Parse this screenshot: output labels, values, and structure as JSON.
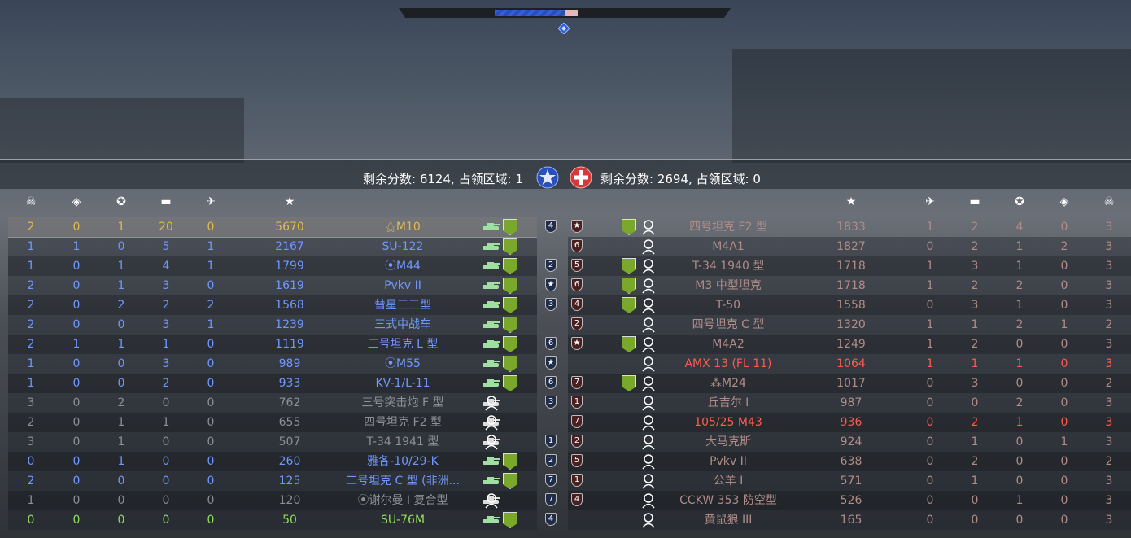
{
  "top": {
    "blue_team_emblem": "star-emblem-icon",
    "red_team_emblem": "cross-emblem-icon"
  },
  "score": {
    "left_text": "剩余分数: 6124, 占领区域: 1",
    "right_text": "剩余分数: 2694, 占领区域: 0"
  },
  "left_headers": [
    "skull-icon",
    "capture-icon",
    "assist-icon",
    "ground-kill-icon",
    "air-kill-icon",
    "score-star-icon"
  ],
  "left_players": [
    {
      "deaths": "2",
      "caps": "0",
      "assists": "1",
      "ground": "20",
      "air": "0",
      "score": "5670",
      "vehicle": "⚝M10",
      "shield": "4",
      "style": "gold"
    },
    {
      "deaths": "1",
      "caps": "1",
      "assists": "0",
      "ground": "5",
      "air": "1",
      "score": "2167",
      "vehicle": "SU-122",
      "shield": "",
      "style": "blue"
    },
    {
      "deaths": "1",
      "caps": "0",
      "assists": "1",
      "ground": "4",
      "air": "1",
      "score": "1799",
      "vehicle": "⦿M44",
      "shield": "2",
      "style": "blue"
    },
    {
      "deaths": "2",
      "caps": "0",
      "assists": "1",
      "ground": "3",
      "air": "0",
      "score": "1619",
      "vehicle": "Pvkv II",
      "shield": "★",
      "style": "blue"
    },
    {
      "deaths": "2",
      "caps": "0",
      "assists": "2",
      "ground": "2",
      "air": "2",
      "score": "1568",
      "vehicle": "彗星三三型",
      "shield": "3",
      "style": "blue"
    },
    {
      "deaths": "2",
      "caps": "0",
      "assists": "0",
      "ground": "3",
      "air": "1",
      "score": "1239",
      "vehicle": "三式中战车",
      "shield": "",
      "style": "blue"
    },
    {
      "deaths": "2",
      "caps": "1",
      "assists": "1",
      "ground": "1",
      "air": "0",
      "score": "1119",
      "vehicle": "三号坦克 L 型",
      "shield": "6",
      "style": "blue"
    },
    {
      "deaths": "1",
      "caps": "0",
      "assists": "0",
      "ground": "3",
      "air": "0",
      "score": "989",
      "vehicle": "⦿M55",
      "shield": "★",
      "style": "blue"
    },
    {
      "deaths": "1",
      "caps": "0",
      "assists": "0",
      "ground": "2",
      "air": "0",
      "score": "933",
      "vehicle": "KV-1/L-11",
      "shield": "6",
      "style": "blue"
    },
    {
      "deaths": "3",
      "caps": "0",
      "assists": "2",
      "ground": "0",
      "air": "0",
      "score": "762",
      "vehicle": "三号突击炮 F 型",
      "shield": "3",
      "style": "grey"
    },
    {
      "deaths": "2",
      "caps": "0",
      "assists": "1",
      "ground": "1",
      "air": "0",
      "score": "655",
      "vehicle": "四号坦克 F2 型",
      "shield": "",
      "style": "grey"
    },
    {
      "deaths": "3",
      "caps": "0",
      "assists": "1",
      "ground": "0",
      "air": "0",
      "score": "507",
      "vehicle": "T-34 1941 型",
      "shield": "1",
      "style": "grey"
    },
    {
      "deaths": "0",
      "caps": "0",
      "assists": "1",
      "ground": "0",
      "air": "0",
      "score": "260",
      "vehicle": "雅各-10/29-K",
      "shield": "2",
      "style": "blue"
    },
    {
      "deaths": "2",
      "caps": "0",
      "assists": "0",
      "ground": "0",
      "air": "0",
      "score": "125",
      "vehicle": "二号坦克 C 型 (非洲...",
      "shield": "7",
      "style": "blue"
    },
    {
      "deaths": "1",
      "caps": "0",
      "assists": "0",
      "ground": "0",
      "air": "0",
      "score": "120",
      "vehicle": "⦿谢尔曼 I 复合型",
      "shield": "7",
      "style": "grey"
    },
    {
      "deaths": "0",
      "caps": "0",
      "assists": "0",
      "ground": "0",
      "air": "0",
      "score": "50",
      "vehicle": "SU-76M",
      "shield": "4",
      "style": "green"
    }
  ],
  "right_players": [
    {
      "shield": "★",
      "vehicle": "四号坦克 F2 型",
      "score": "1833",
      "air": "1",
      "ground": "2",
      "assists": "4",
      "caps": "0",
      "deaths": "3",
      "style": "redgrey",
      "rank": true
    },
    {
      "shield": "6",
      "vehicle": "M4A1",
      "score": "1827",
      "air": "0",
      "ground": "2",
      "assists": "1",
      "caps": "2",
      "deaths": "3",
      "style": "redgrey",
      "rank": false
    },
    {
      "shield": "5",
      "vehicle": "T-34 1940 型",
      "score": "1718",
      "air": "1",
      "ground": "3",
      "assists": "1",
      "caps": "0",
      "deaths": "3",
      "style": "redgrey",
      "rank": true
    },
    {
      "shield": "6",
      "vehicle": "M3 中型坦克",
      "score": "1718",
      "air": "1",
      "ground": "2",
      "assists": "2",
      "caps": "0",
      "deaths": "3",
      "style": "redgrey",
      "rank": true
    },
    {
      "shield": "4",
      "vehicle": "T-50",
      "score": "1558",
      "air": "0",
      "ground": "3",
      "assists": "1",
      "caps": "0",
      "deaths": "3",
      "style": "redgrey",
      "rank": true
    },
    {
      "shield": "2",
      "vehicle": "四号坦克 C 型",
      "score": "1320",
      "air": "1",
      "ground": "1",
      "assists": "2",
      "caps": "1",
      "deaths": "2",
      "style": "redgrey",
      "rank": false
    },
    {
      "shield": "★",
      "vehicle": "M4A2",
      "score": "1249",
      "air": "1",
      "ground": "2",
      "assists": "0",
      "caps": "0",
      "deaths": "3",
      "style": "redgrey",
      "rank": true
    },
    {
      "shield": "",
      "vehicle": "AMX 13 (FL 11)",
      "score": "1064",
      "air": "1",
      "ground": "1",
      "assists": "1",
      "caps": "0",
      "deaths": "3",
      "style": "red",
      "rank": false
    },
    {
      "shield": "7",
      "vehicle": "⁂M24",
      "score": "1017",
      "air": "0",
      "ground": "3",
      "assists": "0",
      "caps": "0",
      "deaths": "2",
      "style": "redgrey",
      "rank": true
    },
    {
      "shield": "1",
      "vehicle": "丘吉尔 I",
      "score": "987",
      "air": "0",
      "ground": "0",
      "assists": "2",
      "caps": "0",
      "deaths": "3",
      "style": "redgrey",
      "rank": false
    },
    {
      "shield": "7",
      "vehicle": "105/25 M43",
      "score": "936",
      "air": "0",
      "ground": "2",
      "assists": "1",
      "caps": "0",
      "deaths": "3",
      "style": "red",
      "rank": false
    },
    {
      "shield": "2",
      "vehicle": "大马克斯",
      "score": "924",
      "air": "0",
      "ground": "1",
      "assists": "0",
      "caps": "1",
      "deaths": "3",
      "style": "redgrey",
      "rank": false
    },
    {
      "shield": "5",
      "vehicle": "Pvkv II",
      "score": "638",
      "air": "0",
      "ground": "2",
      "assists": "0",
      "caps": "0",
      "deaths": "2",
      "style": "redgrey",
      "rank": false
    },
    {
      "shield": "1",
      "vehicle": "公羊 I",
      "score": "571",
      "air": "0",
      "ground": "1",
      "assists": "0",
      "caps": "0",
      "deaths": "3",
      "style": "redgrey",
      "rank": false
    },
    {
      "shield": "4",
      "vehicle": "CCKW 353 防空型",
      "score": "526",
      "air": "0",
      "ground": "0",
      "assists": "1",
      "caps": "0",
      "deaths": "3",
      "style": "redgrey",
      "rank": false
    },
    {
      "shield": "",
      "vehicle": "黄鼠狼 III",
      "score": "165",
      "air": "0",
      "ground": "0",
      "assists": "0",
      "caps": "0",
      "deaths": "3",
      "style": "redgrey",
      "rank": false
    }
  ],
  "colors": {
    "blue": "#6f97ff",
    "gold": "#e3b94a",
    "grey": "#8c8f94",
    "red": "#ff5a4c",
    "redgrey": "#b08c88",
    "green": "#8fdc5a"
  }
}
